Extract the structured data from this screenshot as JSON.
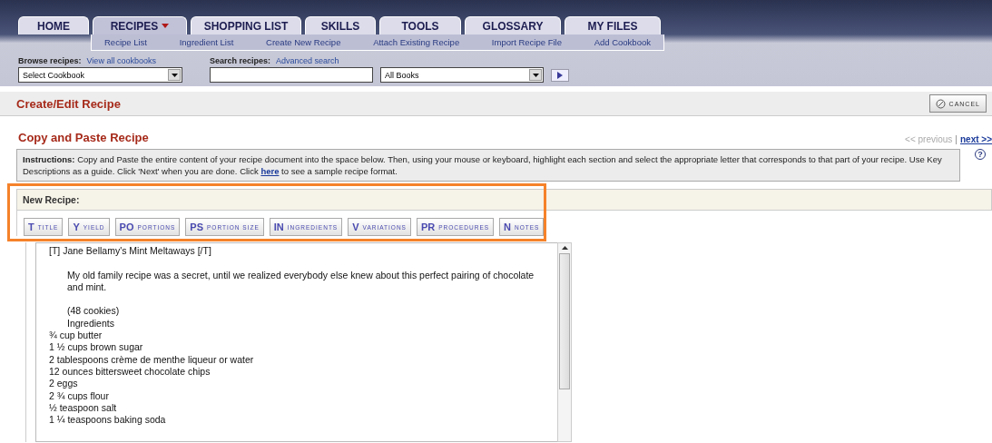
{
  "tabs": [
    {
      "label": "HOME",
      "selected": false,
      "menu": false
    },
    {
      "label": "RECIPES",
      "selected": true,
      "menu": true
    },
    {
      "label": "SHOPPING LIST",
      "selected": false,
      "menu": false
    },
    {
      "label": "SKILLS",
      "selected": false,
      "menu": false
    },
    {
      "label": "TOOLS",
      "selected": false,
      "menu": false
    },
    {
      "label": "GLOSSARY",
      "selected": false,
      "menu": false
    },
    {
      "label": "MY FILES",
      "selected": false,
      "menu": false
    }
  ],
  "subnav": [
    "Recipe List",
    "Ingredient List",
    "Create New Recipe",
    "Attach Existing Recipe",
    "Import Recipe File",
    "Add Cookbook"
  ],
  "browse": {
    "label": "Browse recipes:",
    "link": "View all cookbooks",
    "select": "Select Cookbook"
  },
  "search": {
    "label": "Search recipes:",
    "link": "Advanced search",
    "scope": "All Books"
  },
  "page_title": "Create/Edit Recipe",
  "cancel_button": "CANCEL",
  "section_title": "Copy and Paste Recipe",
  "pager": {
    "previous": "<< previous",
    "separator": "|",
    "next": "next >>"
  },
  "help": "?",
  "instructions": {
    "lead": "Instructions:",
    "before": "Copy and Paste the entire content of your recipe document into the space below. Then, using your mouse or keyboard, highlight each section and select the appropriate letter that corresponds to that part of your recipe. Use Key Descriptions as a guide. Click 'Next' when you are done. Click",
    "link": "here",
    "after": "to see a sample recipe format."
  },
  "new_recipe": {
    "title": "New Recipe:",
    "highlighted": true,
    "keys": [
      {
        "key": "T",
        "label": "TITLE"
      },
      {
        "key": "Y",
        "label": "YIELD"
      },
      {
        "key": "PO",
        "label": "PORTIONS"
      },
      {
        "key": "PS",
        "label": "PORTION SIZE"
      },
      {
        "key": "IN",
        "label": "INGREDIENTS"
      },
      {
        "key": "V",
        "label": "VARIATIONS"
      },
      {
        "key": "PR",
        "label": "PROCEDURES"
      },
      {
        "key": "N",
        "label": "NOTES"
      }
    ]
  },
  "recipe_text": [
    {
      "text": "[T] Jane Bellamy's Mint Meltaways [/T]",
      "indented": false
    },
    {
      "text": "My old family recipe was a secret, until we realized everybody else knew about this perfect pairing of chocolate and mint.",
      "indented": true,
      "space_before": true
    },
    {
      "text": "(48 cookies)",
      "indented": true,
      "space_before": true
    },
    {
      "text": "Ingredients",
      "indented": true
    },
    {
      "text": "¾ cup butter",
      "indented": false
    },
    {
      "text": "1 ½ cups brown sugar",
      "indented": false
    },
    {
      "text": "2 tablespoons crème de menthe liqueur or water",
      "indented": false
    },
    {
      "text": "12 ounces bittersweet chocolate chips",
      "indented": false
    },
    {
      "text": "2 eggs",
      "indented": false
    },
    {
      "text": "2 ¾ cups flour",
      "indented": false
    },
    {
      "text": "½ teaspoon salt",
      "indented": false
    },
    {
      "text": "1 ¼ teaspoons baking soda",
      "indented": false
    }
  ]
}
